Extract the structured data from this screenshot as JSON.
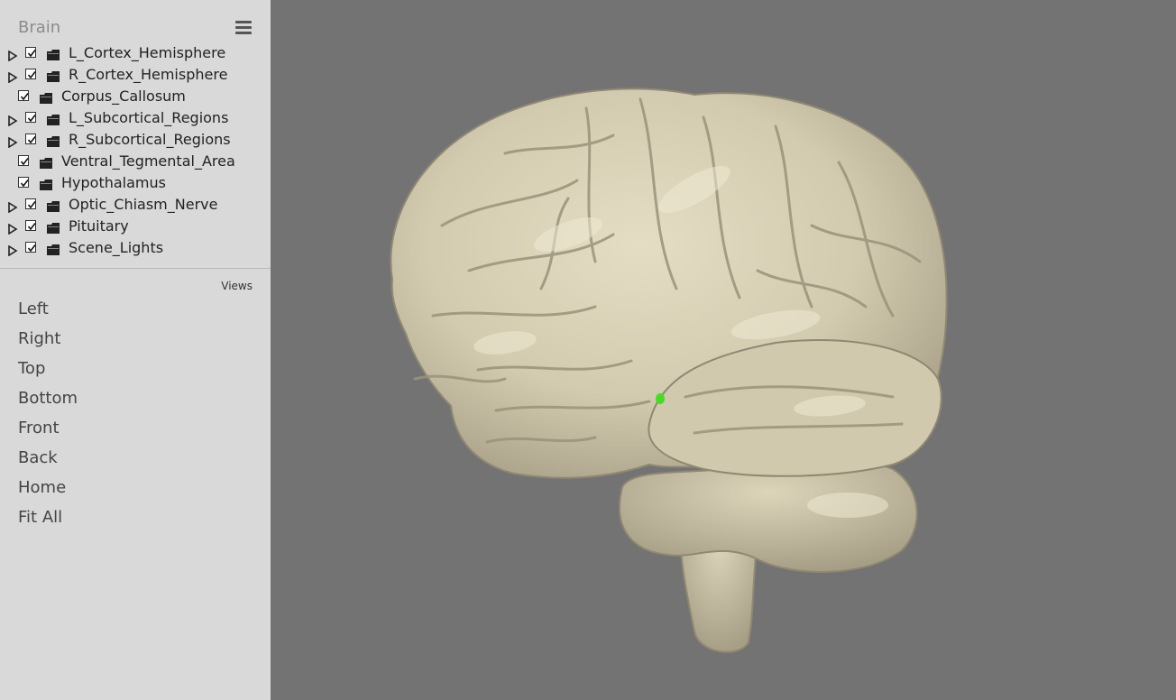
{
  "scene_tree": {
    "title": "Brain",
    "items": [
      {
        "label": "L_Cortex_Hemisphere",
        "expandable": true,
        "checked": true
      },
      {
        "label": "R_Cortex_Hemisphere",
        "expandable": true,
        "checked": true
      },
      {
        "label": "Corpus_Callosum",
        "expandable": false,
        "checked": true
      },
      {
        "label": "L_Subcortical_Regions",
        "expandable": true,
        "checked": true
      },
      {
        "label": "R_Subcortical_Regions",
        "expandable": true,
        "checked": true
      },
      {
        "label": "Ventral_Tegmental_Area",
        "expandable": false,
        "checked": true
      },
      {
        "label": "Hypothalamus",
        "expandable": false,
        "checked": true
      },
      {
        "label": "Optic_Chiasm_Nerve",
        "expandable": true,
        "checked": true
      },
      {
        "label": "Pituitary",
        "expandable": true,
        "checked": true
      },
      {
        "label": "Scene_Lights",
        "expandable": true,
        "checked": true
      }
    ]
  },
  "views": {
    "title": "Views",
    "items": [
      "Left",
      "Right",
      "Top",
      "Bottom",
      "Front",
      "Back",
      "Home",
      "Fit All"
    ]
  },
  "colors": {
    "sidebar_bg": "#d9d9d9",
    "viewport_bg": "#737373",
    "brain_tissue": "#d6cfb4",
    "highlight": "#44dd22"
  },
  "icons": {
    "menu": "hamburger-menu-icon",
    "expand": "triangle-right-icon",
    "checkbox": "checkbox-checked-icon",
    "node": "folder-icon"
  }
}
